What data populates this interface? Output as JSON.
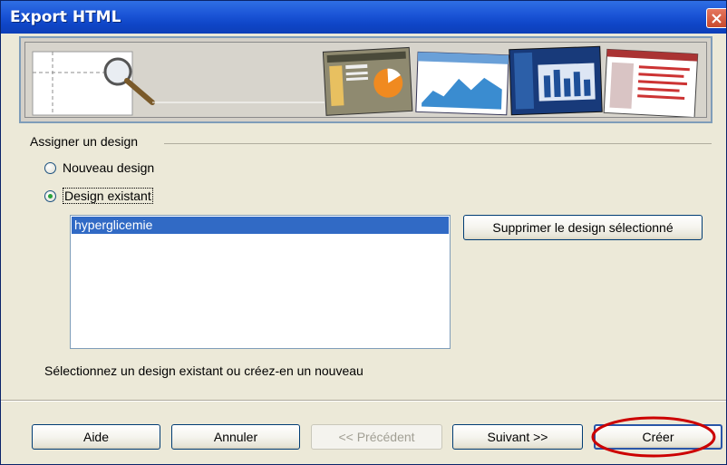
{
  "window": {
    "title": "Export HTML"
  },
  "group": {
    "label": "Assigner un design"
  },
  "options": [
    {
      "label": "Nouveau design",
      "checked": false
    },
    {
      "label": "Design existant",
      "checked": true
    }
  ],
  "design_list": {
    "items": [
      "hyperglicemie"
    ],
    "selected": "hyperglicemie"
  },
  "delete_button": {
    "label": "Supprimer le design sélectionné"
  },
  "hint": "Sélectionnez un design existant ou créez-en un nouveau",
  "buttons": {
    "help": "Aide",
    "cancel": "Annuler",
    "previous": "<< Précédent",
    "next": "Suivant >>",
    "create": "Créer"
  },
  "colors": {
    "titlebar": "#0d3fb8",
    "selection": "#316ac5",
    "annotation": "#cc0000"
  }
}
